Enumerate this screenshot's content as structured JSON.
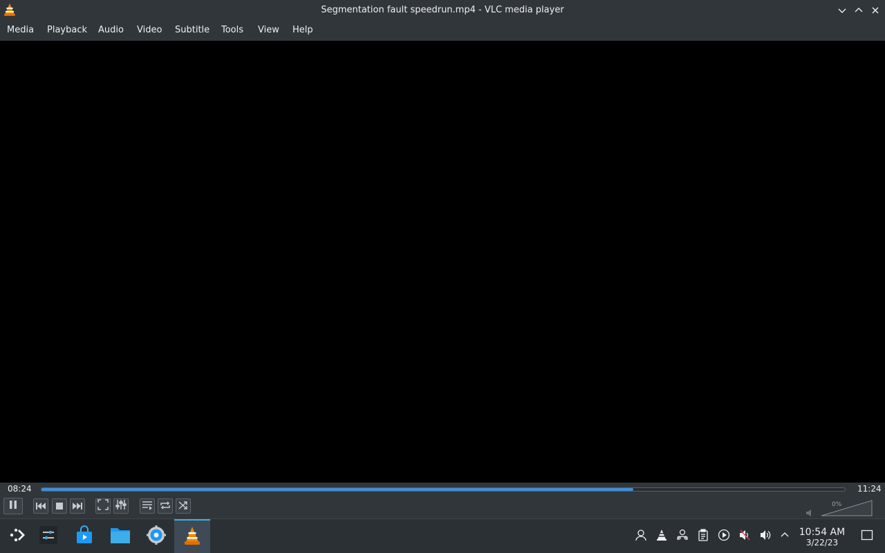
{
  "window": {
    "title": "Segmentation fault speedrun.mp4 - VLC media player",
    "app_icon": "vlc-cone-icon",
    "buttons": [
      "minimize-icon",
      "maximize-icon",
      "close-icon"
    ]
  },
  "menu": {
    "items": [
      {
        "label": "Media"
      },
      {
        "label": "Playback"
      },
      {
        "label": "Audio"
      },
      {
        "label": "Video"
      },
      {
        "label": "Subtitle"
      },
      {
        "label": "Tools"
      },
      {
        "label": "View"
      },
      {
        "label": "Help"
      }
    ]
  },
  "player": {
    "elapsed": "08:24",
    "total": "11:24",
    "progress_fraction": 0.737,
    "volume_label": "0%",
    "volume_fraction": 0.0,
    "controls": [
      "pause-icon",
      "previous-icon",
      "stop-icon",
      "next-icon",
      "fullscreen-icon",
      "extended-settings-icon",
      "playlist-icon",
      "loop-icon",
      "shuffle-icon"
    ]
  },
  "taskbar": {
    "apps": [
      "app-launcher-icon",
      "settings-panel-icon",
      "discover-store-icon",
      "file-manager-icon",
      "system-settings-icon",
      "vlc-icon"
    ],
    "tray": [
      "user-icon",
      "vlc-tray-icon",
      "accounts-icon",
      "clipboard-icon",
      "media-player-icon",
      "audio-muted-icon",
      "volume-icon",
      "expand-tray-icon"
    ],
    "clock_time": "10:54 AM",
    "clock_date": "3/22/23",
    "show_desktop_icon": "show-desktop-icon"
  },
  "colors": {
    "accent": "#3d8fd9",
    "panel": "#31363b",
    "taskbar": "#2b3035",
    "vlc_orange": "#f08a00"
  }
}
